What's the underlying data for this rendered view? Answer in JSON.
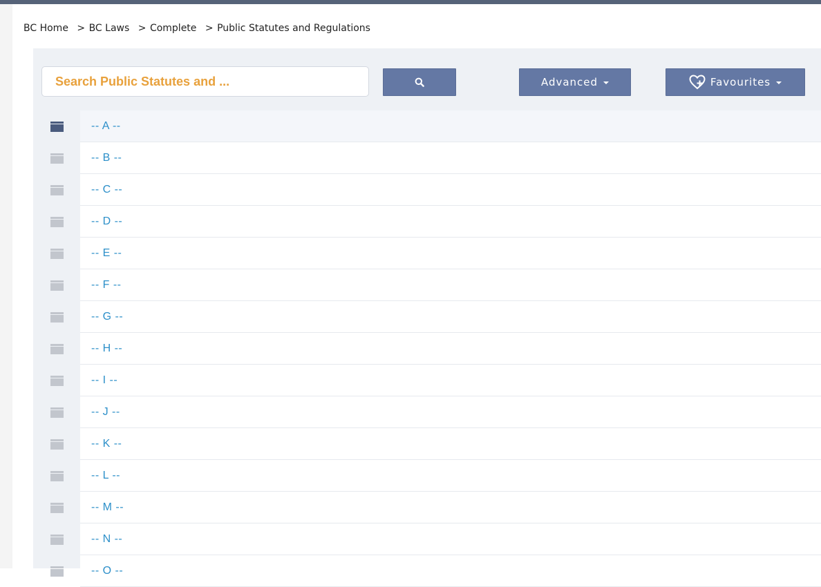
{
  "breadcrumb": [
    {
      "label": "BC Home"
    },
    {
      "label": "BC Laws"
    },
    {
      "label": "Complete"
    },
    {
      "label": "Public Statutes and Regulations"
    }
  ],
  "breadcrumb_separator": ">",
  "search": {
    "placeholder": "Search Public Statutes and ...",
    "value": ""
  },
  "toolbar": {
    "search_icon": "search-icon",
    "advanced_label": "Advanced",
    "favourites_label": "Favourites",
    "favourites_icon": "heart-plus-icon"
  },
  "colors": {
    "primary_button": "#6478a4",
    "link": "#2c8fc9",
    "placeholder": "#e8a13c",
    "top_bar": "#566379",
    "folder_active": "#4a5b7e",
    "folder_inactive": "#c2c6cd"
  },
  "items": [
    {
      "label": "-- A --",
      "active": true
    },
    {
      "label": "-- B --"
    },
    {
      "label": "-- C --"
    },
    {
      "label": "-- D --"
    },
    {
      "label": "-- E --"
    },
    {
      "label": "-- F --"
    },
    {
      "label": "-- G --"
    },
    {
      "label": "-- H --"
    },
    {
      "label": "-- I --"
    },
    {
      "label": "-- J --"
    },
    {
      "label": "-- K --"
    },
    {
      "label": "-- L --"
    },
    {
      "label": "-- M --"
    },
    {
      "label": "-- N --"
    },
    {
      "label": "-- O --"
    }
  ]
}
